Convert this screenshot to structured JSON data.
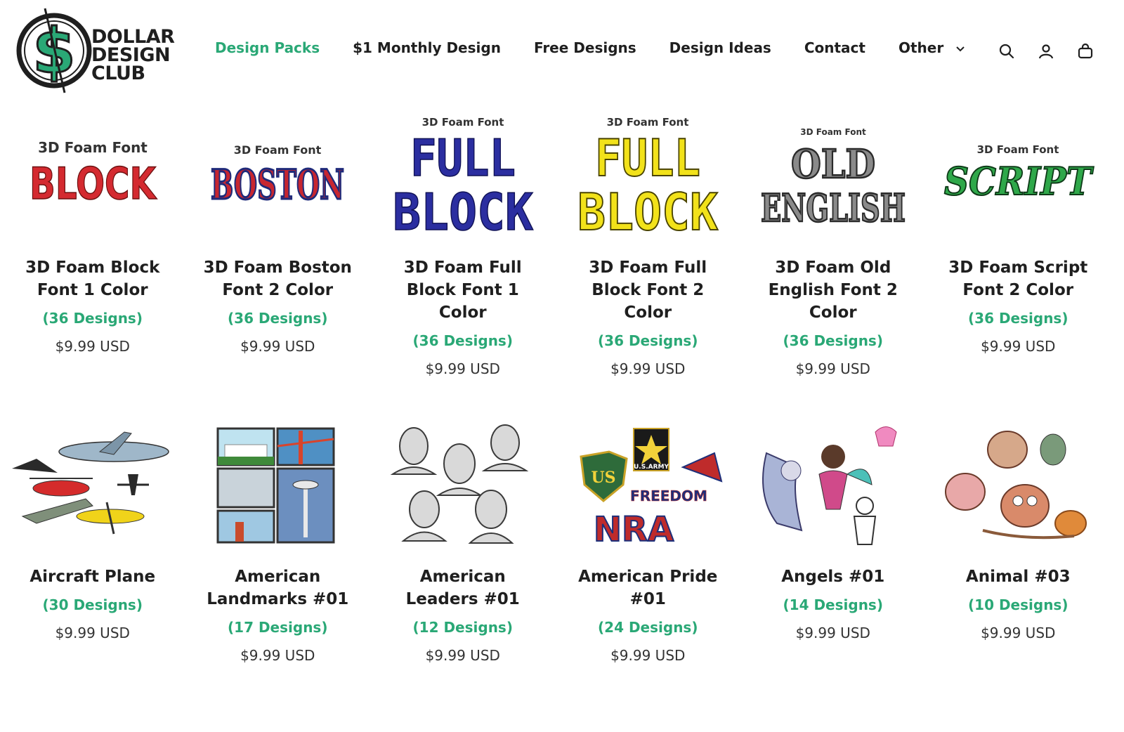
{
  "brand": {
    "line1": "DOLLAR",
    "line2": "DESIGN",
    "line3": "CLUB",
    "logo_letter": "$"
  },
  "nav": {
    "items": [
      {
        "label": "Design Packs",
        "active": true
      },
      {
        "label": "$1 Monthly Design",
        "active": false
      },
      {
        "label": "Free Designs",
        "active": false
      },
      {
        "label": "Design Ideas",
        "active": false
      },
      {
        "label": "Contact",
        "active": false
      },
      {
        "label": "Other",
        "active": false
      }
    ]
  },
  "header_icons": [
    "search-icon",
    "account-icon",
    "cart-icon"
  ],
  "colors": {
    "accent": "#2aa876",
    "text": "#1f1f1f"
  },
  "products": [
    {
      "title": "3D Foam Block Font 1 Color",
      "count": "(36 Designs)",
      "price": "$9.99 USD",
      "thumb": {
        "top": "3D Foam Font",
        "main": "BLOCK",
        "color": "#d42a30"
      }
    },
    {
      "title": "3D Foam Boston Font 2 Color",
      "count": "(36 Designs)",
      "price": "$9.99 USD",
      "thumb": {
        "top": "3D Foam Font",
        "main": "BOSTON",
        "color": "#c72630"
      }
    },
    {
      "title": "3D Foam Full Block Font 1 Color",
      "count": "(36 Designs)",
      "price": "$9.99 USD",
      "thumb": {
        "top": "3D Foam Font",
        "main1": "FULL",
        "main2": "BLOCK",
        "color": "#2b2ea0"
      }
    },
    {
      "title": "3D Foam Full Block Font 2 Color",
      "count": "(36 Designs)",
      "price": "$9.99 USD",
      "thumb": {
        "top": "3D Foam Font",
        "main1": "FULL",
        "main2": "BLOCK",
        "color": "#f2e21a"
      }
    },
    {
      "title": "3D Foam Old English Font 2 Color",
      "count": "(36 Designs)",
      "price": "$9.99 USD",
      "thumb": {
        "top": "3D Foam Font",
        "main1": "OLD",
        "main2": "ENGLISH",
        "color": "#8a8a8a"
      }
    },
    {
      "title": "3D Foam Script Font 2 Color",
      "count": "(36 Designs)",
      "price": "$9.99 USD",
      "thumb": {
        "top": "3D Foam Font",
        "main": "SCRIPT",
        "color": "#2fa84a"
      }
    },
    {
      "title": "Aircraft Plane",
      "count": "(30 Designs)",
      "price": "$9.99 USD"
    },
    {
      "title": "American Landmarks #01",
      "count": "(17 Designs)",
      "price": "$9.99 USD"
    },
    {
      "title": "American Leaders #01",
      "count": "(12 Designs)",
      "price": "$9.99 USD"
    },
    {
      "title": "American Pride #01",
      "count": "(24 Designs)",
      "price": "$9.99 USD",
      "thumb": {
        "army": "U.S.ARMY",
        "shield": "US",
        "freedom": "FREEDOM",
        "nra": "NRA"
      }
    },
    {
      "title": "Angels #01",
      "count": "(14 Designs)",
      "price": "$9.99 USD"
    },
    {
      "title": "Animal #03",
      "count": "(10 Designs)",
      "price": "$9.99 USD"
    }
  ]
}
